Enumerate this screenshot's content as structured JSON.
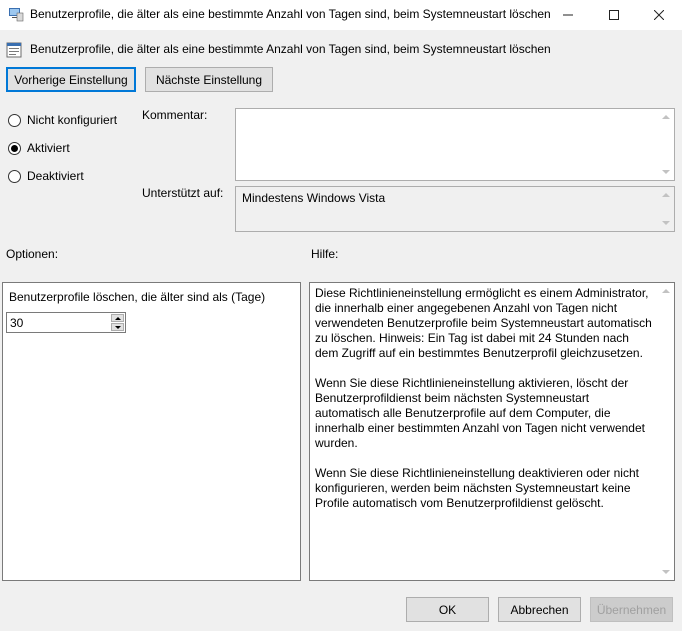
{
  "window": {
    "title": "Benutzerprofile, die älter als eine bestimmte Anzahl von Tagen sind, beim Systemneustart löschen",
    "icon": "group-policy-icon"
  },
  "header": {
    "policy_title": "Benutzerprofile, die älter als eine bestimmte Anzahl von Tagen sind, beim Systemneustart löschen",
    "prev_button": "Vorherige Einstellung",
    "next_button": "Nächste Einstellung"
  },
  "state": {
    "options": [
      {
        "label": "Nicht konfiguriert",
        "checked": false
      },
      {
        "label": "Aktiviert",
        "checked": true
      },
      {
        "label": "Deaktiviert",
        "checked": false
      }
    ]
  },
  "comment": {
    "label": "Kommentar:",
    "value": ""
  },
  "supported": {
    "label": "Unterstützt auf:",
    "value": "Mindestens Windows Vista"
  },
  "options_section": {
    "label": "Optionen:",
    "field_label": "Benutzerprofile löschen, die älter sind als (Tage)",
    "field_value": "30"
  },
  "help_section": {
    "label": "Hilfe:",
    "paragraphs": [
      "Diese Richtlinieneinstellung ermöglicht es einem Administrator, die innerhalb einer angegebenen Anzahl von Tagen nicht verwendeten Benutzerprofile beim Systemneustart automatisch zu löschen. Hinweis: Ein Tag ist dabei mit 24 Stunden nach dem Zugriff auf ein bestimmtes Benutzerprofil gleichzusetzen.",
      "Wenn Sie diese Richtlinieneinstellung aktivieren, löscht der Benutzerprofildienst beim nächsten Systemneustart automatisch alle Benutzerprofile auf dem Computer, die innerhalb einer bestimmten Anzahl von Tagen nicht verwendet wurden.",
      "Wenn Sie diese Richtlinieneinstellung deaktivieren oder nicht konfigurieren, werden beim nächsten Systemneustart keine Profile automatisch vom Benutzerprofildienst gelöscht."
    ]
  },
  "footer": {
    "ok": "OK",
    "cancel": "Abbrechen",
    "apply": "Übernehmen"
  },
  "colors": {
    "accent": "#0078d7",
    "window_bg": "#f0f0f0"
  }
}
